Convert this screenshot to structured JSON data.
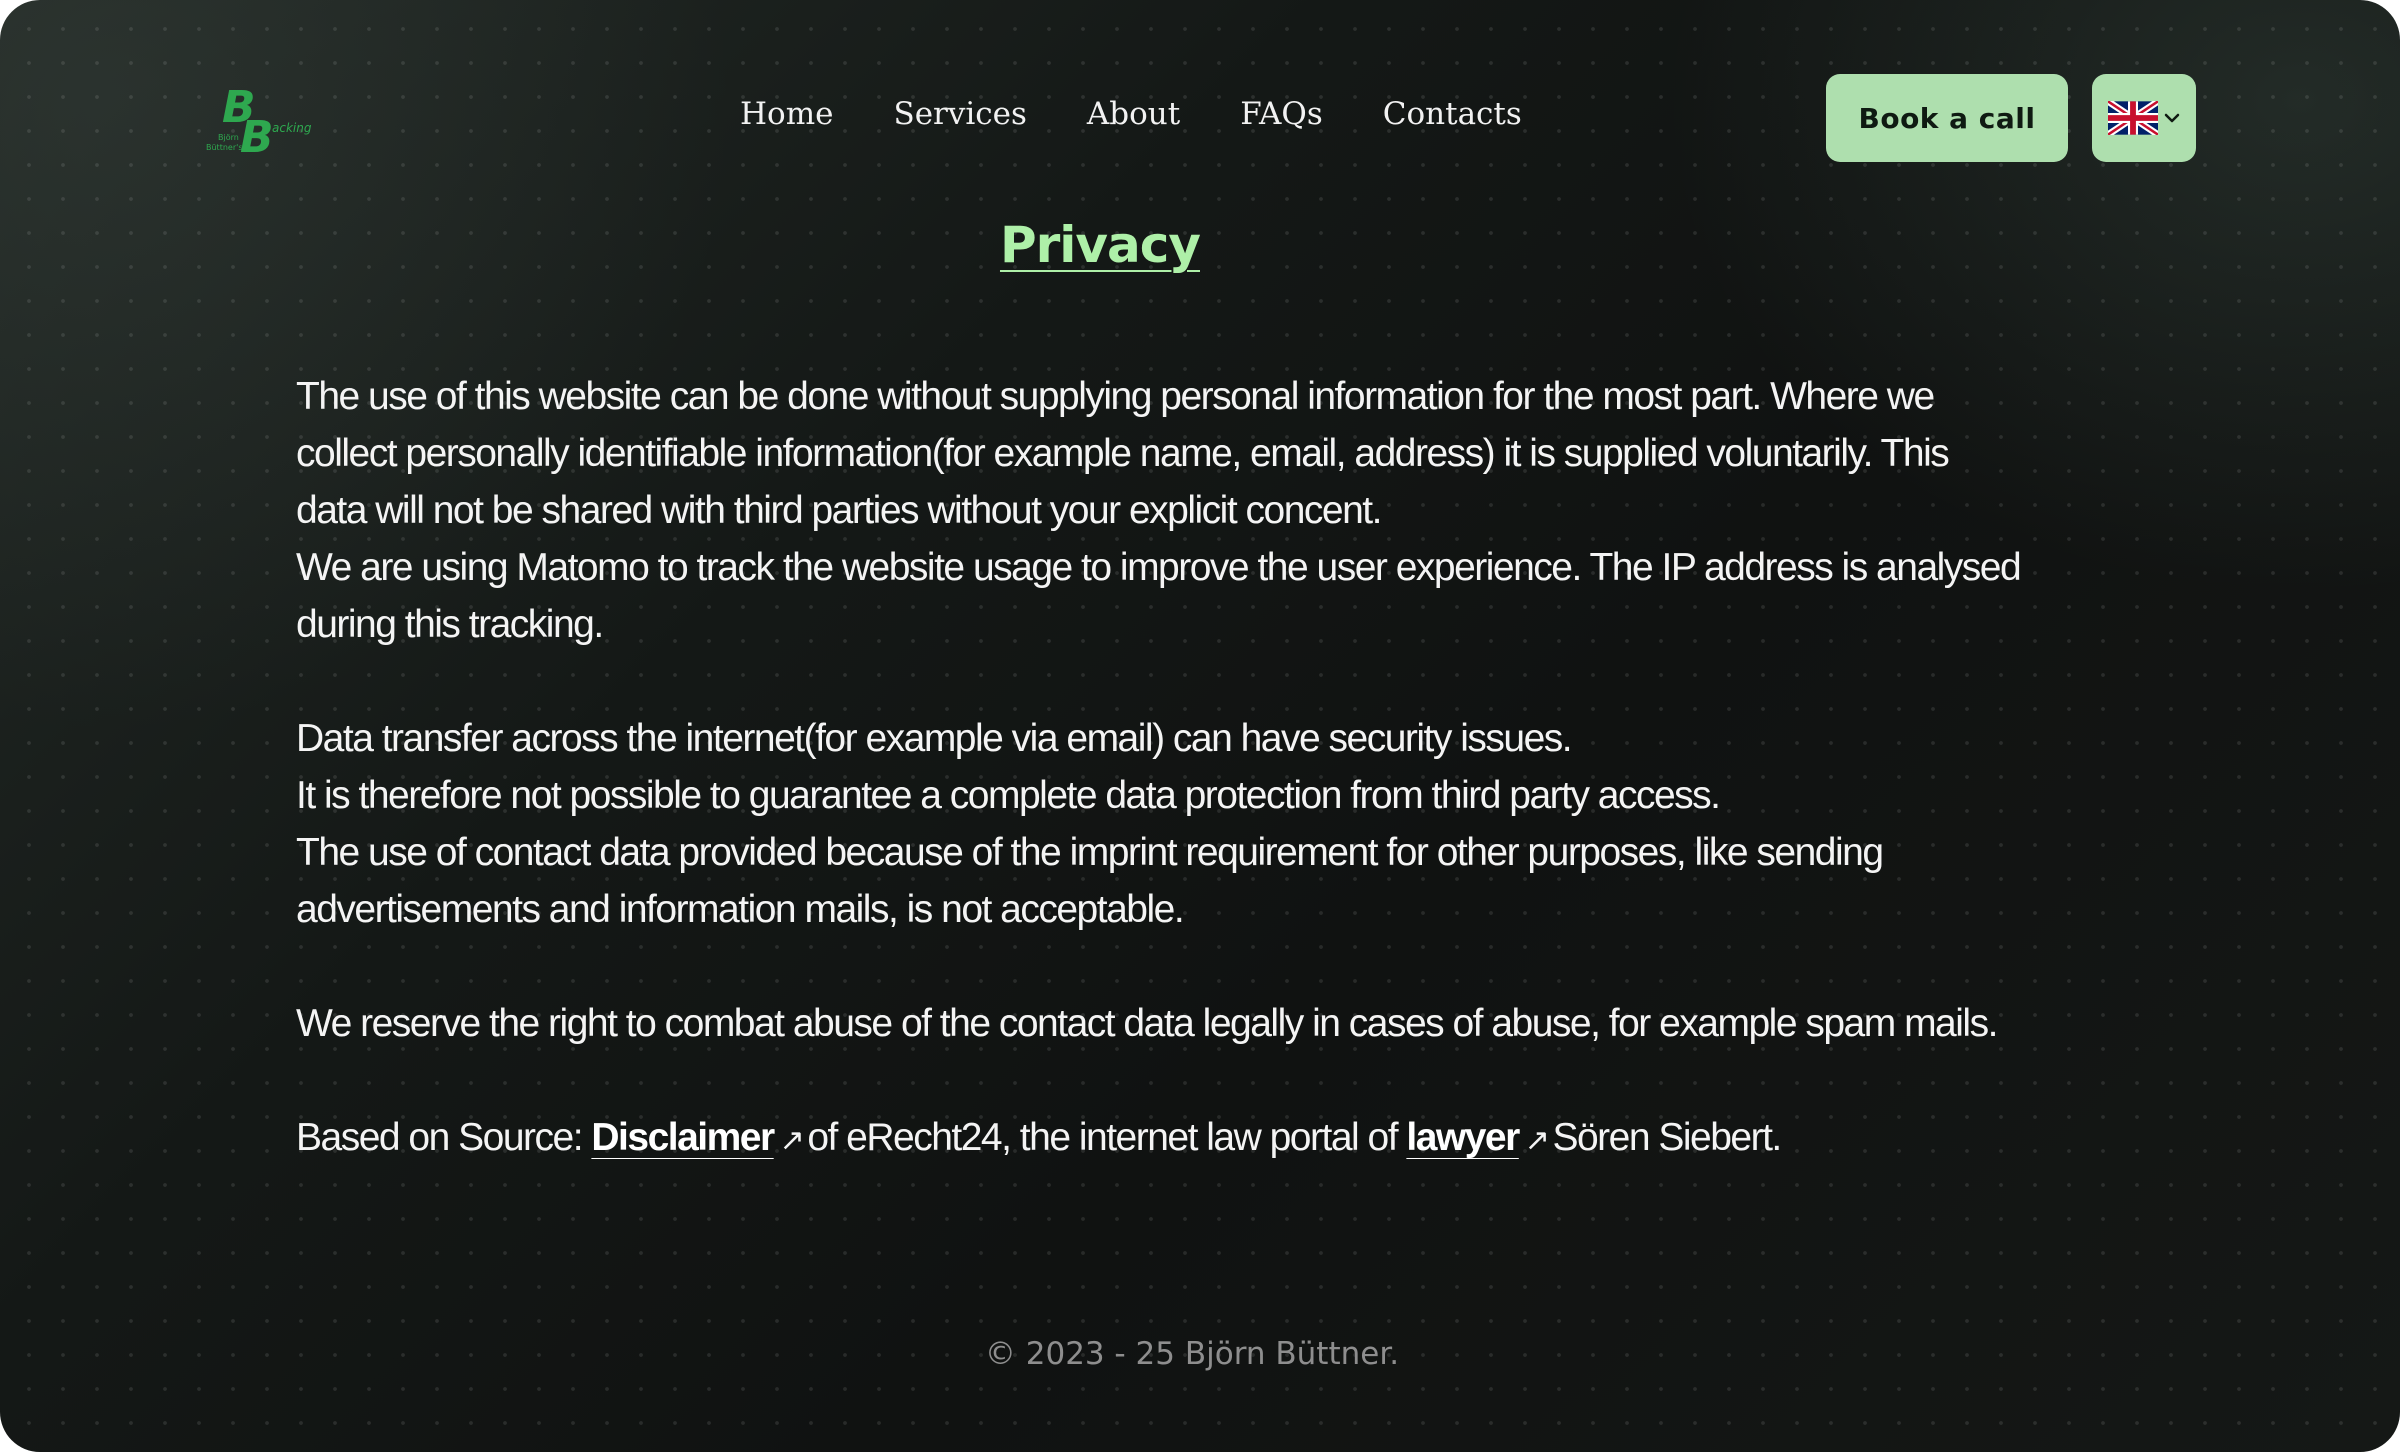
{
  "brand": {
    "logo_main": "BB",
    "logo_small_1": "Björn",
    "logo_small_2": "Büttner's",
    "logo_small_3": "acking",
    "logo_color": "#2ea84f"
  },
  "nav": {
    "items": [
      {
        "label": "Home"
      },
      {
        "label": "Services"
      },
      {
        "label": "About"
      },
      {
        "label": "FAQs"
      },
      {
        "label": "Contacts"
      }
    ]
  },
  "header": {
    "book_label": "Book a call",
    "language_icon": "uk-flag-icon"
  },
  "page": {
    "title": "Privacy"
  },
  "content": {
    "p1_l1": "The use of this website can be done without supplying personal information for the most part. Where we",
    "p1_l2": "collect personally identifiable information(for example name, email, address) it is supplied voluntarily. This",
    "p1_l3": "data will not be shared with third parties without your explicit concent.",
    "p2_l1": "We are using Matomo to track the website usage to improve the user experience. The IP address is analysed",
    "p2_l2": "during this tracking.",
    "p3_l1": "Data transfer across the internet(for example via email) can have security issues.",
    "p3_l2": "It is therefore not possible to guarantee a complete data protection from third party access.",
    "p3_l3": "The use of contact data provided because of the imprint requirement for other purposes, like sending",
    "p3_l4": "advertisements and information mails, is not acceptable.",
    "p4_l1": "We reserve the right to combat abuse of the contact data legally in cases of abuse, for example spam mails.",
    "source_prefix": "Based on Source: ",
    "source_link1": "Disclaimer",
    "source_mid": "of eRecht24, the internet law portal of ",
    "source_link2": "lawyer",
    "source_suffix": "Sören Siebert.",
    "arrow_icon": "↗"
  },
  "footer": {
    "copyright": "© 2023 - 25 Björn Büttner."
  },
  "colors": {
    "accent": "#aedfae",
    "title": "#aef0a8",
    "background": "#141816"
  }
}
